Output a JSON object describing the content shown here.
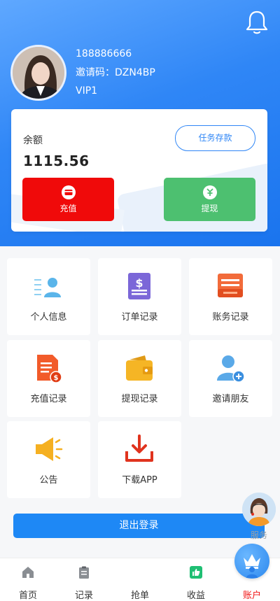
{
  "user": {
    "phone": "188886666",
    "invite_code": "邀请码：DZN4BP",
    "level": "VIP1"
  },
  "balance": {
    "label": "余额",
    "value": "1115.56",
    "deposit_label": "任务存款",
    "recharge_label": "充值",
    "withdraw_label": "提现"
  },
  "menu": {
    "personal_info": "个人信息",
    "order_records": "订单记录",
    "account_records": "账务记录",
    "recharge_records": "充值记录",
    "withdraw_records": "提现记录",
    "invite_friends": "邀请朋友",
    "notice": "公告",
    "download_app": "下载APP"
  },
  "logout_label": "退出登录",
  "service_label": "服务",
  "tabs": {
    "home": "首页",
    "records": "记录",
    "grab": "抢单",
    "income": "收益",
    "account": "账户"
  },
  "colors": {
    "primary": "#1e88f5",
    "recharge": "#f00a0a",
    "withdraw": "#4dc070",
    "active_tab": "#f01414"
  }
}
